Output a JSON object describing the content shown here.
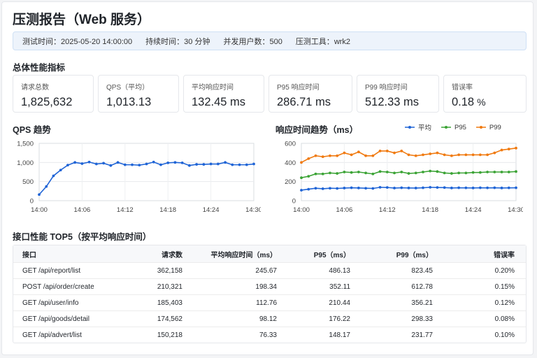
{
  "title": "压测报告（Web 服务）",
  "info": [
    {
      "label": "测试时间：",
      "value": "2025-05-20 14:00:00"
    },
    {
      "label": "持续时间：",
      "value": "30 分钟"
    },
    {
      "label": "并发用户数：",
      "value": "500"
    },
    {
      "label": "压测工具：",
      "value": "wrk2"
    }
  ],
  "metrics_title": "总体性能指标",
  "metrics": [
    {
      "label": "请求总数",
      "value": "1,825,632",
      "unit": ""
    },
    {
      "label": "QPS（平均）",
      "value": "1,013.13",
      "unit": ""
    },
    {
      "label": "平均响应时间",
      "value": "132.45 ms",
      "unit": ""
    },
    {
      "label": "P95 响应时间",
      "value": "286.71 ms",
      "unit": ""
    },
    {
      "label": "P99 响应时间",
      "value": "512.33 ms",
      "unit": ""
    },
    {
      "label": "错误率",
      "value": "0.18",
      "unit": "%"
    }
  ],
  "colors": {
    "blue": "#1f64d6",
    "green": "#3ba335",
    "orange": "#f07a10"
  },
  "chart_data": [
    {
      "type": "line",
      "title": "QPS 趋势",
      "x_ticks": [
        "14:00",
        "14:06",
        "14:12",
        "14:18",
        "14:24",
        "14:30"
      ],
      "y_ticks": [
        "0",
        "500",
        "1,000",
        "1,500"
      ],
      "xlim": [
        0,
        30
      ],
      "ylim": [
        0,
        1500
      ],
      "x": [
        0,
        1,
        2,
        3,
        4,
        5,
        6,
        7,
        8,
        9,
        10,
        11,
        12,
        13,
        14,
        15,
        16,
        17,
        18,
        19,
        20,
        21,
        22,
        23,
        24,
        25,
        26,
        27,
        28,
        29,
        30
      ],
      "series": [
        {
          "color": "#1f64d6",
          "values": [
            160,
            370,
            650,
            800,
            930,
            1000,
            970,
            1010,
            960,
            980,
            920,
            1000,
            940,
            940,
            930,
            960,
            1010,
            940,
            990,
            1000,
            990,
            920,
            950,
            950,
            960,
            960,
            1000,
            940,
            940,
            940,
            960
          ]
        }
      ]
    },
    {
      "type": "line",
      "title": "响应时间趋势（ms）",
      "x_ticks": [
        "14:00",
        "14:06",
        "14:12",
        "14:18",
        "14:24",
        "14:30"
      ],
      "y_ticks": [
        "0",
        "200",
        "400",
        "600"
      ],
      "xlim": [
        0,
        30
      ],
      "ylim": [
        0,
        600
      ],
      "x": [
        0,
        1,
        2,
        3,
        4,
        5,
        6,
        7,
        8,
        9,
        10,
        11,
        12,
        13,
        14,
        15,
        16,
        17,
        18,
        19,
        20,
        21,
        22,
        23,
        24,
        25,
        26,
        27,
        28,
        29,
        30
      ],
      "series": [
        {
          "name": "平均",
          "color": "#1f64d6",
          "values": [
            110,
            120,
            130,
            125,
            130,
            128,
            132,
            135,
            133,
            130,
            128,
            140,
            138,
            132,
            135,
            133,
            132,
            135,
            140,
            138,
            137,
            133,
            135,
            134,
            133,
            135,
            134,
            135,
            133,
            134,
            135
          ]
        },
        {
          "name": "P95",
          "color": "#3ba335",
          "values": [
            240,
            255,
            280,
            280,
            290,
            285,
            300,
            295,
            300,
            290,
            280,
            305,
            300,
            290,
            300,
            285,
            290,
            300,
            310,
            305,
            290,
            285,
            290,
            290,
            295,
            295,
            300,
            300,
            300,
            300,
            305
          ]
        },
        {
          "name": "P99",
          "color": "#f07a10",
          "values": [
            400,
            440,
            470,
            460,
            470,
            470,
            500,
            480,
            510,
            470,
            470,
            520,
            520,
            500,
            520,
            480,
            470,
            480,
            490,
            500,
            480,
            470,
            480,
            480,
            480,
            480,
            480,
            500,
            530,
            540,
            550
          ]
        }
      ]
    }
  ],
  "table": {
    "title": "接口性能 TOP5（按平均响应时间）",
    "headers": [
      "接口",
      "请求数",
      "平均响应时间（ms）",
      "P95（ms）",
      "P99（ms）",
      "错误率"
    ],
    "rows": [
      [
        "GET /api/report/list",
        "362,158",
        "245.67",
        "486.13",
        "823.45",
        "0.20%"
      ],
      [
        "POST /api/order/create",
        "210,321",
        "198.34",
        "352.11",
        "612.78",
        "0.15%"
      ],
      [
        "GET /api/user/info",
        "185,403",
        "112.76",
        "210.44",
        "356.21",
        "0.12%"
      ],
      [
        "GET /api/goods/detail",
        "174,562",
        "98.12",
        "176.22",
        "298.33",
        "0.08%"
      ],
      [
        "GET /api/advert/list",
        "150,218",
        "76.33",
        "148.17",
        "231.77",
        "0.10%"
      ]
    ]
  }
}
